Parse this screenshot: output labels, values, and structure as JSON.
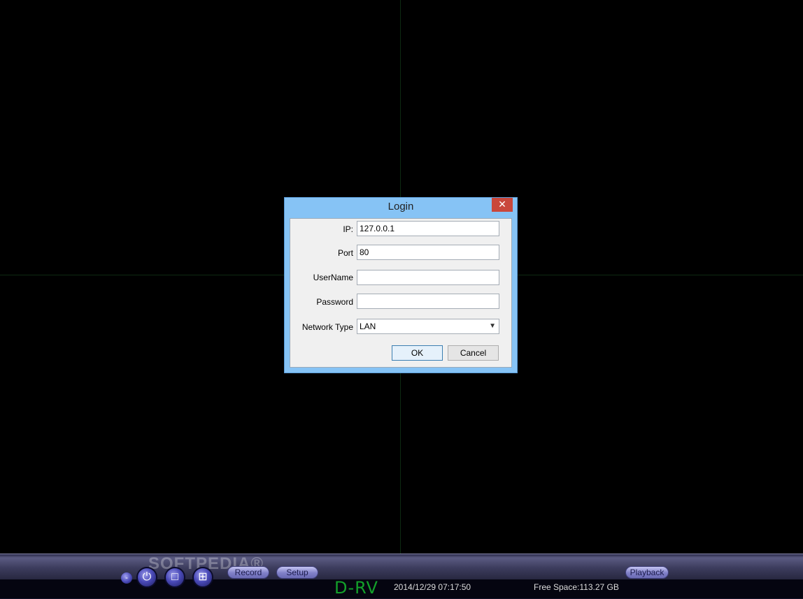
{
  "dialog": {
    "title": "Login",
    "close_glyph": "✕",
    "fields": {
      "ip_label": "IP:",
      "ip_value": "127.0.0.1",
      "port_label": "Port",
      "port_value": "80",
      "username_label": "UserName",
      "username_value": "",
      "password_label": "Password",
      "password_value": "",
      "network_type_label": "Network Type",
      "network_type_value": "LAN"
    },
    "ok_label": "OK",
    "cancel_label": "Cancel"
  },
  "toolbar": {
    "minimize_glyph": "-",
    "power_glyph": "⏻",
    "single_view_glyph": "□",
    "quad_view_glyph": "⊞",
    "record_label": "Record",
    "setup_label": "Setup",
    "playback_label": "Playback"
  },
  "status": {
    "logo": "D-RV",
    "datetime": "2014/12/29 07:17:50",
    "free_space": "Free Space:113.27 GB"
  },
  "watermark": "SOFTPEDIA®",
  "colors": {
    "dialog_frame": "#86c3f5",
    "close_button": "#c9473c",
    "logo": "#13a02a",
    "toolbar_button": "#4a4ab8"
  }
}
